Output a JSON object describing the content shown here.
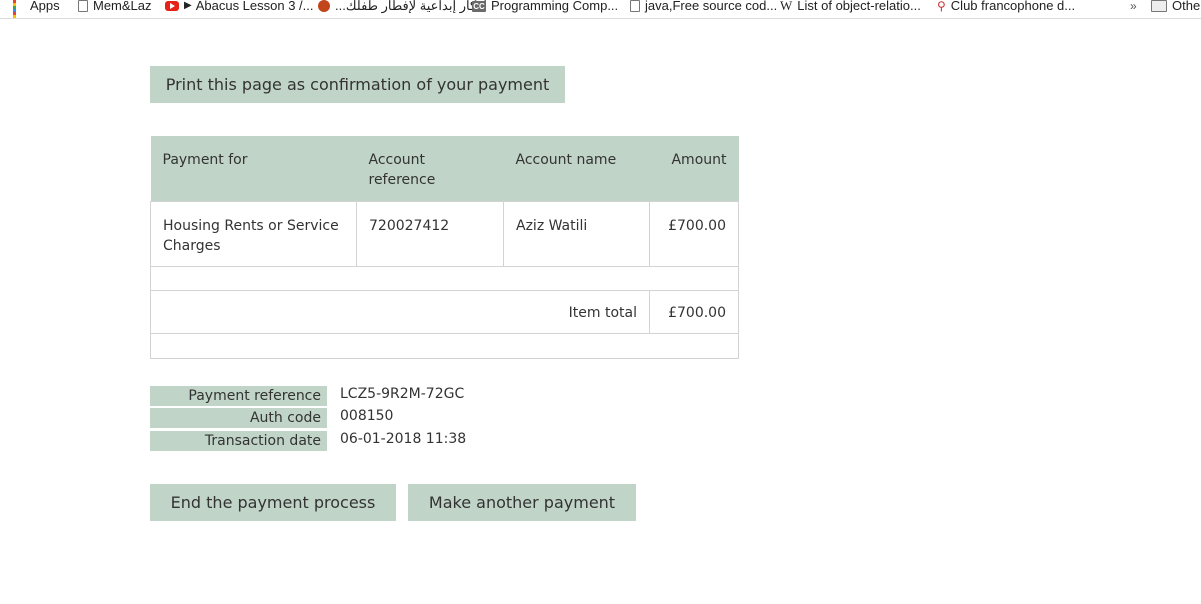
{
  "bookmarks": [
    {
      "label": "Apps",
      "icon": "apps-grid-icon"
    },
    {
      "label": "Mem&Laz",
      "icon": "page-icon"
    },
    {
      "label": "Abacus Lesson 3 /...",
      "icon": "youtube-icon"
    },
    {
      "label": "أفكار إبداعية لإفطار طفلك...",
      "icon": "orange-site-icon"
    },
    {
      "label": "Programming Comp...",
      "icon": "cc-icon"
    },
    {
      "label": "java,Free source cod...",
      "icon": "page-icon"
    },
    {
      "label": "List of object-relatio...",
      "icon": "wikipedia-icon"
    },
    {
      "label": "Club francophone d...",
      "icon": "club-icon"
    },
    {
      "label": "»",
      "icon": "chevron-icon"
    },
    {
      "label": "Other",
      "icon": "folder-icon"
    }
  ],
  "print_button": "Print this page as confirmation of your payment",
  "table": {
    "headers": [
      "Payment for",
      "Account reference",
      "Account name",
      "Amount"
    ],
    "rows": [
      [
        "Housing Rents or Service Charges",
        "720027412",
        "Aziz Watili",
        "£700.00"
      ]
    ],
    "item_total_label": "Item total",
    "item_total_value": "£700.00"
  },
  "summary": [
    {
      "label": "Payment reference",
      "value": "LCZ5-9R2M-72GC"
    },
    {
      "label": "Auth code",
      "value": "008150"
    },
    {
      "label": "Transaction date",
      "value": "06-01-2018 11:38"
    }
  ],
  "buttons": {
    "end": "End the payment process",
    "another": "Make another payment"
  },
  "colors": {
    "accent": "#c0d4c8"
  }
}
